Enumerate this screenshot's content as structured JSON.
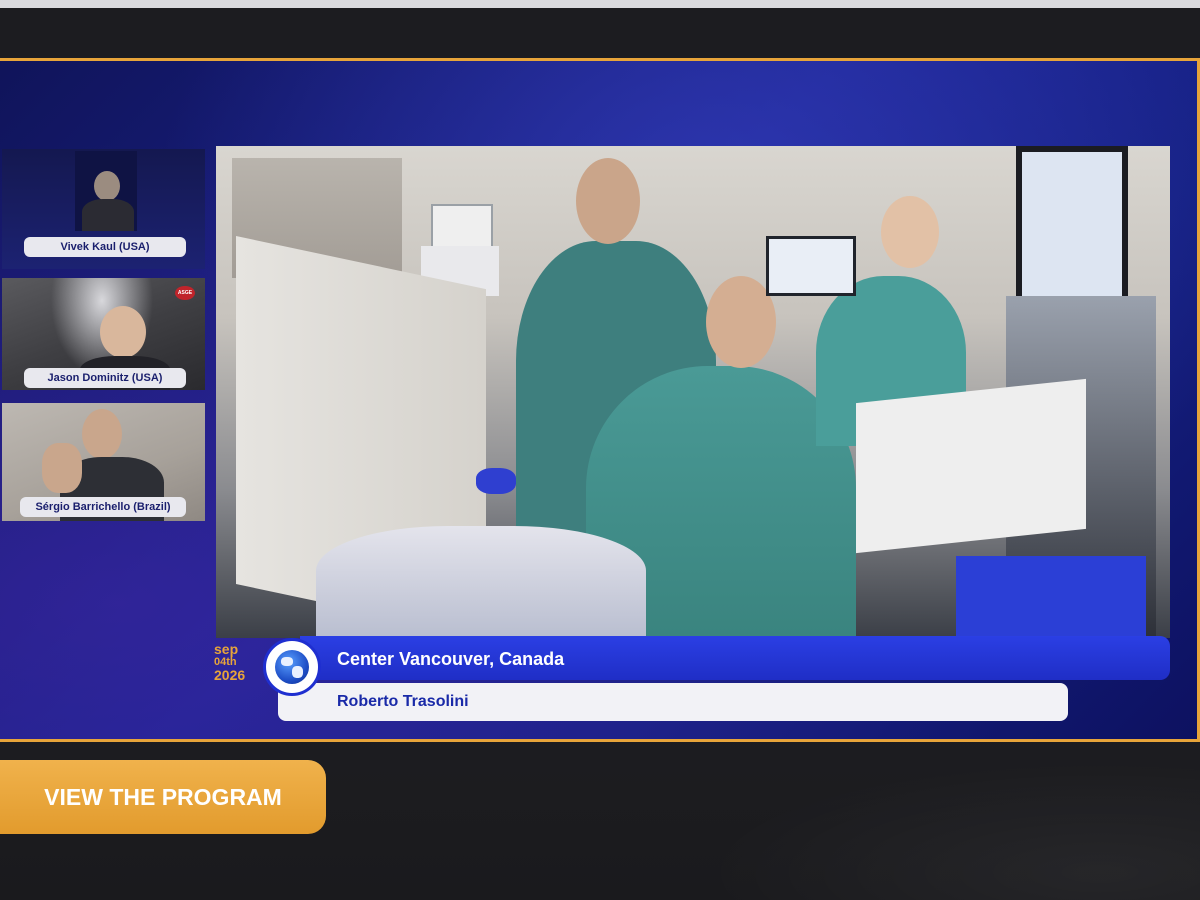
{
  "speakers": [
    {
      "name": "Vivek Kaul (USA)"
    },
    {
      "name": "Jason Dominitz (USA)"
    },
    {
      "name": "Sérgio Barrichello (Brazil)"
    }
  ],
  "speaker_badge": "ASGE",
  "date_badge": {
    "month": "sep",
    "day": "04th",
    "year": "2026"
  },
  "lower_third": {
    "location": "Center Vancouver, Canada",
    "presenter": "Roberto Trasolini"
  },
  "program_button": {
    "label": "VIEW THE PROGRAM"
  },
  "colors": {
    "accent": "#e7a43a",
    "stage_blue": "#1b2391",
    "bar_blue": "#2b3fe4"
  }
}
